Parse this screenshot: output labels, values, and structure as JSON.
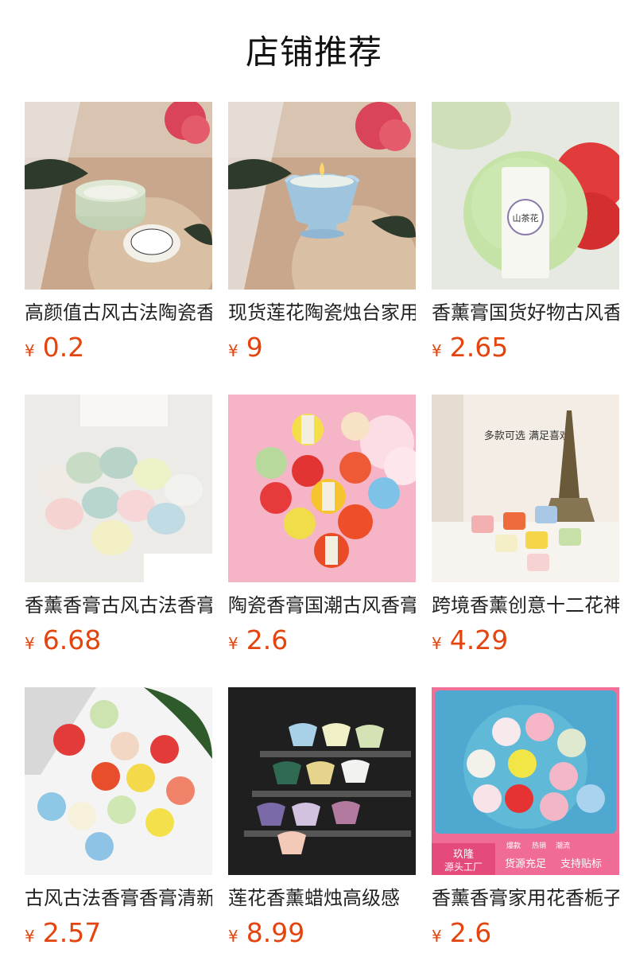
{
  "section": {
    "title": "店铺推荐"
  },
  "colors": {
    "price": "#e4440d",
    "title": "#111111",
    "text": "#222222"
  },
  "products": [
    {
      "name": "高颜值古风古法陶瓷香薰",
      "currency": "¥",
      "price": "0.2",
      "image": "celadon-lotus-jar-with-lid"
    },
    {
      "name": "现货莲花陶瓷烛台家用",
      "currency": "¥",
      "price": "9",
      "image": "blue-lotus-candle"
    },
    {
      "name": "香薰膏国货好物古风香膏",
      "currency": "¥",
      "price": "2.65",
      "image": "green-round-balm-tin",
      "image_label": "山茶花"
    },
    {
      "name": "香薰香膏古风古法香膏",
      "currency": "¥",
      "price": "6.68",
      "image": "pastel-bottle-jars"
    },
    {
      "name": "陶瓷香膏国潮古风香膏",
      "currency": "¥",
      "price": "2.6",
      "image": "colorful-balm-jars-on-pink"
    },
    {
      "name": "跨境香薰创意十二花神",
      "currency": "¥",
      "price": "4.29",
      "image": "tower-with-candle-cups",
      "image_text": [
        "多款可选 满足喜欢"
      ]
    },
    {
      "name": "古风古法香膏香膏清新",
      "currency": "¥",
      "price": "2.57",
      "image": "round-balm-jars-on-white"
    },
    {
      "name": "莲花香薰蜡烛高级感",
      "currency": "¥",
      "price": "8.99",
      "image": "lotus-candles-on-acrylic-stand"
    },
    {
      "name": "香薰香膏家用花香栀子",
      "currency": "¥",
      "price": "2.6",
      "image": "balm-jars-in-water",
      "image_text": [
        "爆款",
        "热销",
        "潮流",
        "玖隆",
        "源头工厂",
        "货源充足",
        "支持贴标"
      ]
    }
  ]
}
